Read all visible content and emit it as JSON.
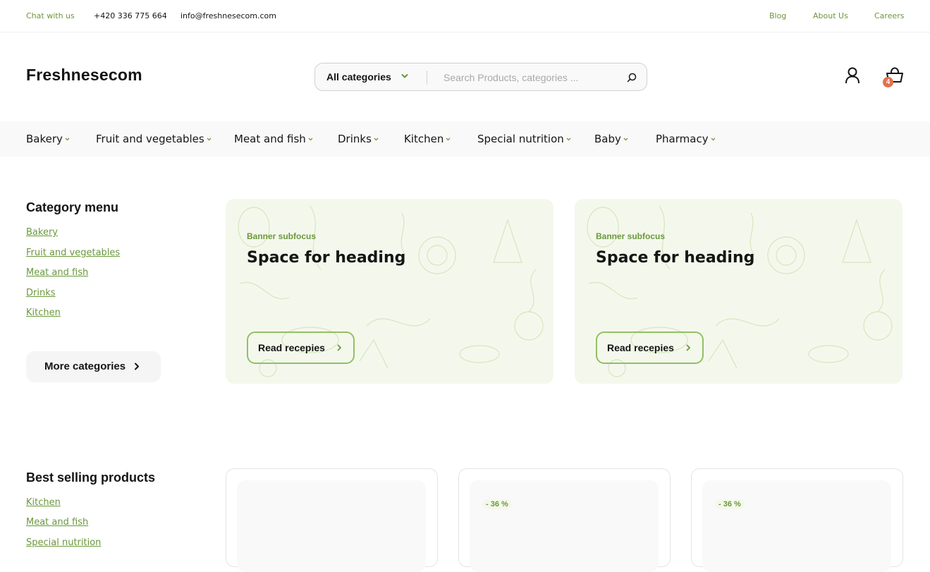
{
  "topbar": {
    "chat": "Chat with us",
    "phone": "+420 336 775 664",
    "email": "info@freshnesecom.com",
    "links": [
      "Blog",
      "About Us",
      "Careers"
    ]
  },
  "header": {
    "logo": "Freshnesecom",
    "search": {
      "category": "All categories",
      "placeholder": "Search Products, categories ..."
    },
    "cart_count": "4"
  },
  "nav": [
    "Bakery",
    "Fruit and vegetables",
    "Meat and fish",
    "Drinks",
    "Kitchen",
    "Special nutrition",
    "Baby",
    "Pharmacy"
  ],
  "category_menu": {
    "title": "Category menu",
    "items": [
      "Bakery",
      "Fruit and vegetables",
      "Meat and fish",
      "Drinks",
      "Kitchen"
    ],
    "more_label": "More categories"
  },
  "banners": [
    {
      "subfocus": "Banner subfocus",
      "heading": "Space for heading",
      "button": "Read recepies"
    },
    {
      "subfocus": "Banner subfocus",
      "heading": "Space for heading",
      "button": "Read recepies"
    }
  ],
  "best_selling": {
    "title": "Best selling products",
    "items": [
      "Kitchen",
      "Meat and fish",
      "Special nutrition"
    ]
  },
  "products": [
    {
      "discount": ""
    },
    {
      "discount": "- 36 %"
    },
    {
      "discount": "- 36 %"
    }
  ],
  "colors": {
    "accent": "#6a983c",
    "accent_light": "#92c064",
    "banner_bg": "#f4f8ec",
    "badge": "#e5704b"
  }
}
